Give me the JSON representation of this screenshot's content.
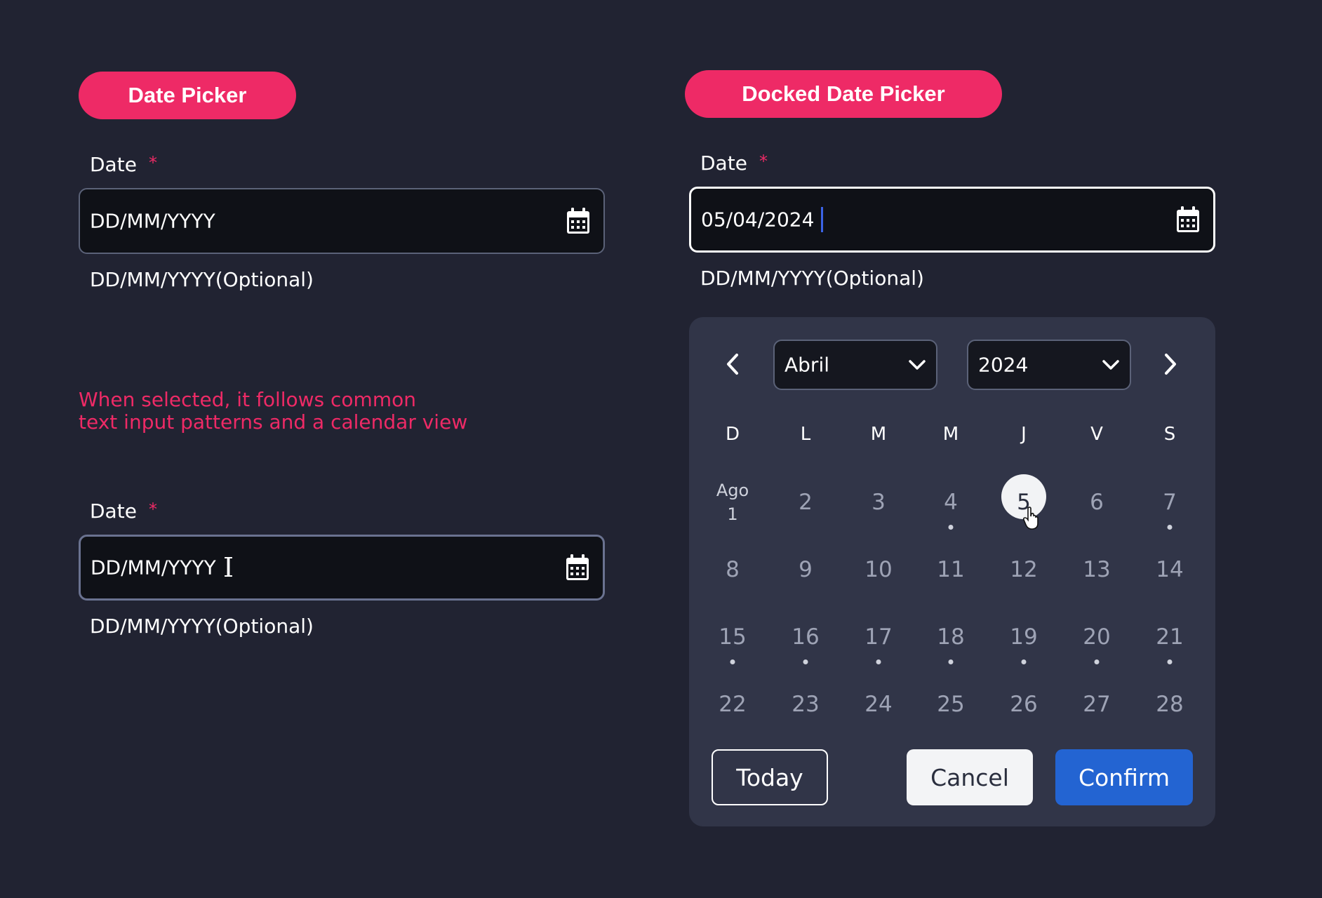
{
  "left": {
    "pill": "Date Picker",
    "field1": {
      "label": "Date",
      "required": "*",
      "value": "DD/MM/YYYY",
      "helper": "DD/MM/YYYY(Optional)"
    },
    "note_line1": "When selected, it follows common",
    "note_line2": "text input patterns and a calendar view",
    "field2": {
      "label": "Date",
      "required": "*",
      "value": "DD/MM/YYYY",
      "helper": "DD/MM/YYYY(Optional)"
    }
  },
  "right": {
    "pill": "Docked Date Picker",
    "field": {
      "label": "Date",
      "required": "*",
      "value": "05/04/2024",
      "helper": "DD/MM/YYYY(Optional)"
    },
    "calendar": {
      "month": "Abril",
      "year": "2024",
      "weekdays": [
        "D",
        "L",
        "M",
        "M",
        "J",
        "V",
        "S"
      ],
      "first_day_month": "Ago",
      "days": [
        "1",
        "2",
        "3",
        "4",
        "5",
        "6",
        "7",
        "8",
        "9",
        "10",
        "11",
        "12",
        "13",
        "14",
        "15",
        "16",
        "17",
        "18",
        "19",
        "20",
        "21",
        "22",
        "23",
        "24",
        "25",
        "26",
        "27",
        "28"
      ],
      "selected_day": "5",
      "days_with_dots": [
        "4",
        "7",
        "15",
        "16",
        "17",
        "18",
        "19",
        "20",
        "21"
      ],
      "buttons": {
        "today": "Today",
        "cancel": "Cancel",
        "confirm": "Confirm"
      }
    }
  },
  "colors": {
    "accent": "#ee2a66",
    "background": "#212332",
    "panel": "#313548",
    "confirm": "#2364d2",
    "caret": "#3b63e6"
  }
}
